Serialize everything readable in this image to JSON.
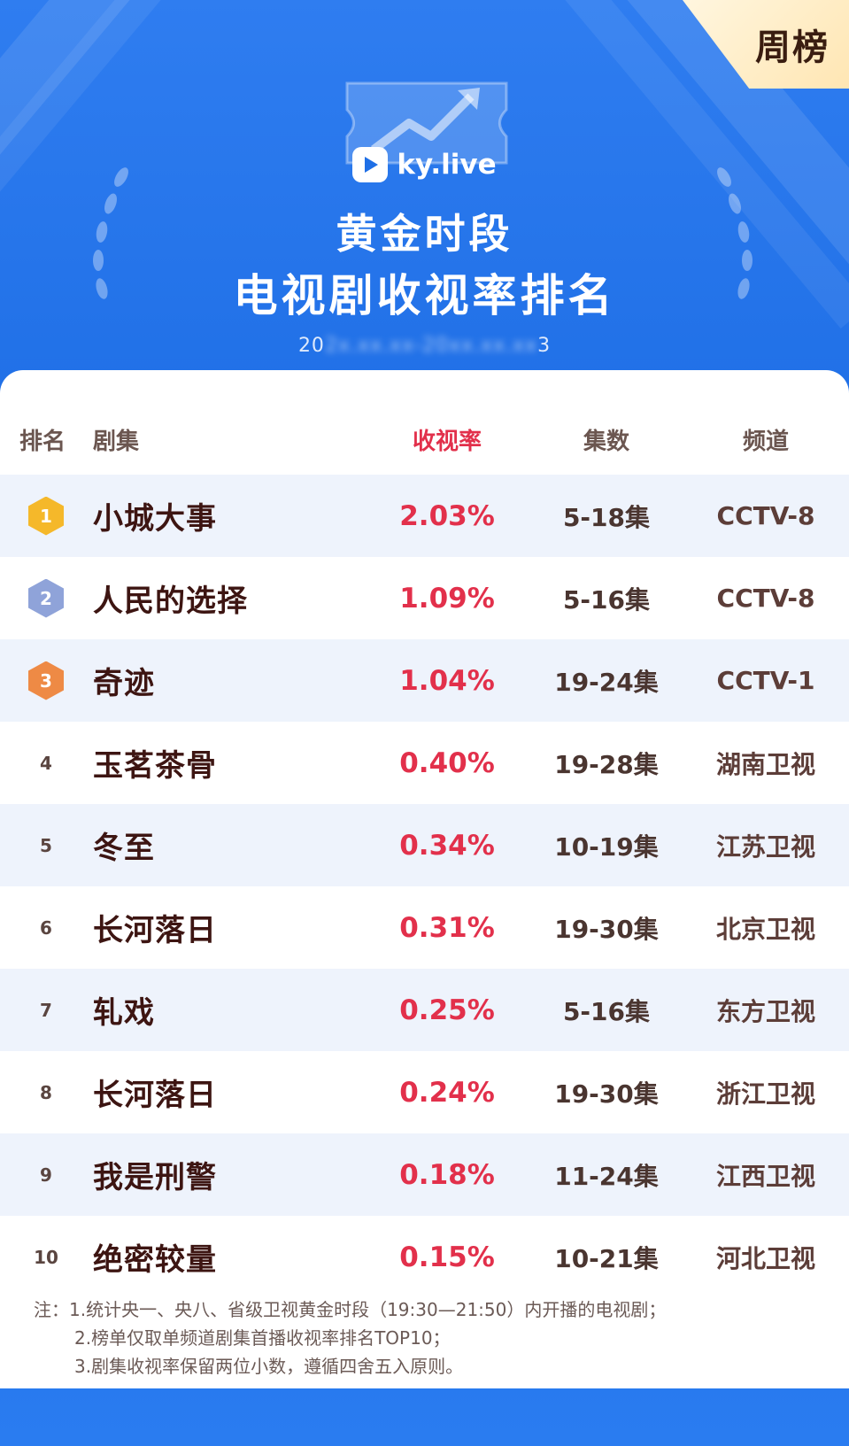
{
  "header": {
    "badge": "周榜",
    "logo_text": "ky.live",
    "title_line1": "黄金时段",
    "title_line2": "电视剧收视率排名",
    "date_prefix": "20",
    "date_blurred": "2x.xx.xx-20xx.xx.xx",
    "date_suffix": "3"
  },
  "table": {
    "headers": {
      "rank": "排名",
      "name": "剧集",
      "rate": "收视率",
      "episodes": "集数",
      "channel": "频道"
    },
    "rows": [
      {
        "rank": "1",
        "name": "小城大事",
        "rate": "2.03%",
        "episodes": "5-18集",
        "channel": "CCTV-8"
      },
      {
        "rank": "2",
        "name": "人民的选择",
        "rate": "1.09%",
        "episodes": "5-16集",
        "channel": "CCTV-8"
      },
      {
        "rank": "3",
        "name": "奇迹",
        "rate": "1.04%",
        "episodes": "19-24集",
        "channel": "CCTV-1"
      },
      {
        "rank": "4",
        "name": "玉茗茶骨",
        "rate": "0.40%",
        "episodes": "19-28集",
        "channel": "湖南卫视"
      },
      {
        "rank": "5",
        "name": "冬至",
        "rate": "0.34%",
        "episodes": "10-19集",
        "channel": "江苏卫视"
      },
      {
        "rank": "6",
        "name": "长河落日",
        "rate": "0.31%",
        "episodes": "19-30集",
        "channel": "北京卫视"
      },
      {
        "rank": "7",
        "name": "轧戏",
        "rate": "0.25%",
        "episodes": "5-16集",
        "channel": "东方卫视"
      },
      {
        "rank": "8",
        "name": "长河落日",
        "rate": "0.24%",
        "episodes": "19-30集",
        "channel": "浙江卫视"
      },
      {
        "rank": "9",
        "name": "我是刑警",
        "rate": "0.18%",
        "episodes": "11-24集",
        "channel": "江西卫视"
      },
      {
        "rank": "10",
        "name": "绝密较量",
        "rate": "0.15%",
        "episodes": "10-21集",
        "channel": "河北卫视"
      }
    ]
  },
  "medal_colors": {
    "gold": "#f5b82a",
    "silver": "#8fa3d9",
    "bronze": "#ee8a45"
  },
  "notes": {
    "line1": "注：1.统计央一、央八、省级卫视黄金时段（19:30—21:50）内开播的电视剧；",
    "line2": "2.榜单仅取单频道剧集首播收视率排名TOP10；",
    "line3": "3.剧集收视率保留两位小数，遵循四舍五入原则。"
  }
}
